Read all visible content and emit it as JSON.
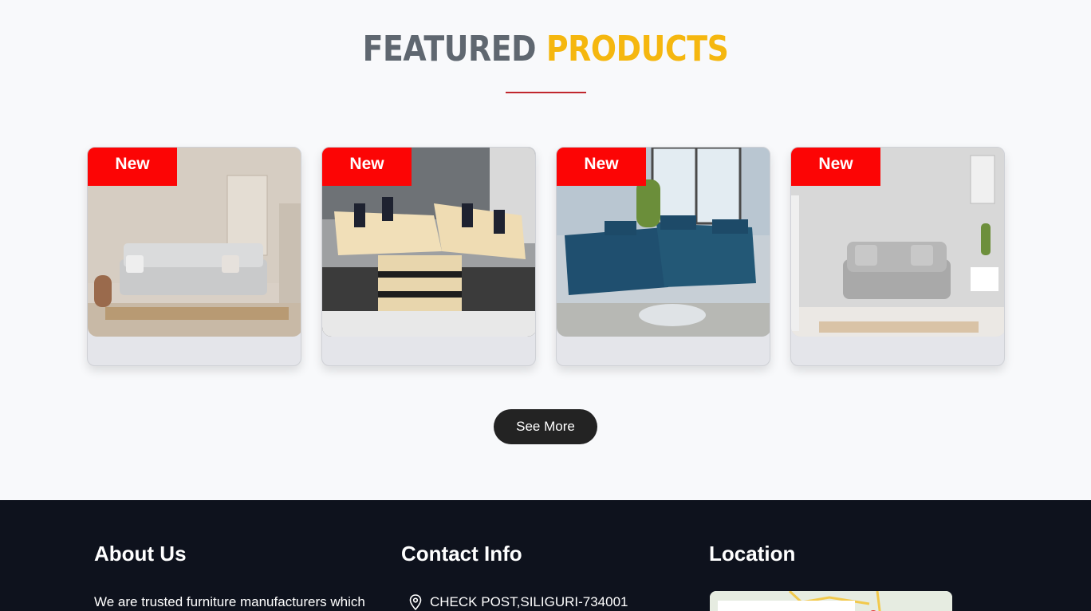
{
  "featured": {
    "heading_part1": "FEATURED",
    "heading_part2": "PRODUCTS",
    "see_more_label": "See More"
  },
  "products": [
    {
      "badge": "New",
      "image": "grey sofa in beige living room"
    },
    {
      "badge": "New",
      "image": "beige and black sectional sofa with coffee table"
    },
    {
      "badge": "New",
      "image": "blue recliner sectional sofa"
    },
    {
      "badge": "New",
      "image": "light grey loveseat in grey room"
    }
  ],
  "footer": {
    "about_title": "About Us",
    "about_text": "We are trusted furniture manufacturers which",
    "contact_title": "Contact Info",
    "address": "CHECK POST,SILIGURI-734001",
    "location_title": "Location"
  },
  "colors": {
    "accent_yellow": "#f5b70f",
    "badge_red": "#fc0505",
    "footer_bg": "#0e121d"
  }
}
